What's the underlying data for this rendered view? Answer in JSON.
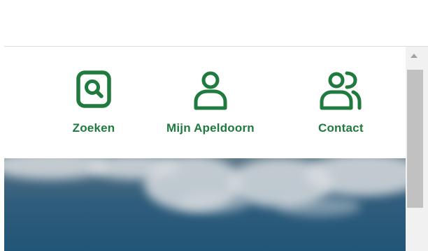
{
  "nav": {
    "search_label": "Zoeken",
    "mijn_label": "Mijn Apeldoorn",
    "contact_label": "Contact"
  },
  "icons": {
    "search": "search-icon",
    "account": "user-icon",
    "contact": "users-icon"
  },
  "colors": {
    "brand_green": "#1f7a3e",
    "sky_blue": "#2a5a7c",
    "scrollbar_thumb": "#c1c1c1"
  }
}
